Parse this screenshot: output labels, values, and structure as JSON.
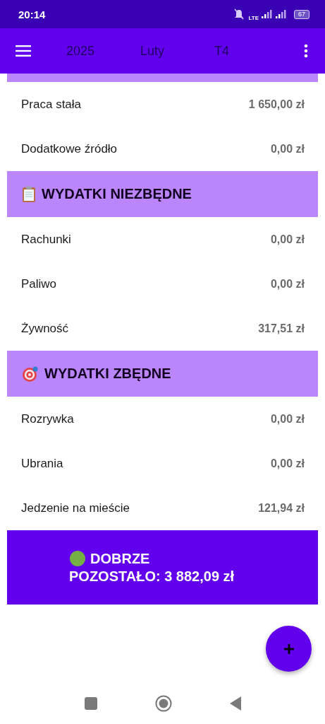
{
  "status_bar": {
    "time": "20:14",
    "network": "LTE",
    "battery": "67"
  },
  "app_bar": {
    "year": "2025",
    "month": "Luty",
    "week": "T4"
  },
  "sections": [
    {
      "rows": [
        {
          "label": "Praca stała",
          "value": "1 650,00 zł"
        },
        {
          "label": "Dodatkowe źródło",
          "value": "0,00 zł"
        }
      ]
    },
    {
      "title": "WYDATKI NIEZBĘDNE",
      "rows": [
        {
          "label": "Rachunki",
          "value": "0,00 zł"
        },
        {
          "label": "Paliwo",
          "value": "0,00 zł"
        },
        {
          "label": "Żywność",
          "value": "317,51 zł"
        }
      ]
    },
    {
      "title": "WYDATKI ZBĘDNE",
      "rows": [
        {
          "label": "Rozrywka",
          "value": "0,00 zł"
        },
        {
          "label": "Ubrania",
          "value": "0,00 zł"
        },
        {
          "label": "Jedzenie na mieście",
          "value": "121,94 zł"
        }
      ]
    }
  ],
  "summary": {
    "status": "DOBRZE",
    "remaining": "POZOSTAŁO: 3 882,09 zł"
  }
}
